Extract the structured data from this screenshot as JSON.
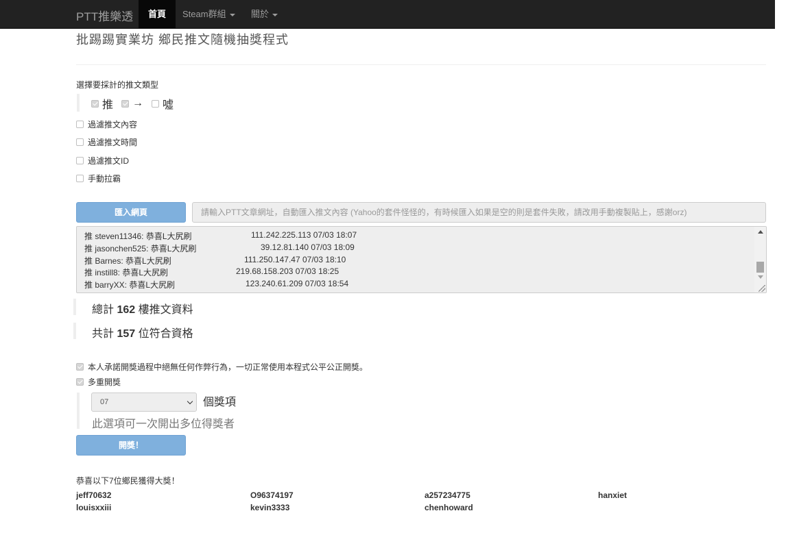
{
  "nav": {
    "brand": "PTT推樂透",
    "items": [
      {
        "label": "首頁"
      },
      {
        "label": "Steam群組"
      },
      {
        "label": "關於"
      }
    ]
  },
  "page": {
    "title": "批踢踢實業坊 鄉民推文隨機抽獎程式",
    "section_label": "選擇要採計的推文類型"
  },
  "push_types": [
    {
      "label": "推",
      "checked": true
    },
    {
      "label": "→",
      "checked": true
    },
    {
      "label": "噓",
      "checked": false
    }
  ],
  "filters": [
    {
      "label": "過濾推文內容",
      "checked": false
    },
    {
      "label": "過濾推文時間",
      "checked": false
    },
    {
      "label": "過濾推文ID",
      "checked": false
    },
    {
      "label": "手動拉霸",
      "checked": false
    }
  ],
  "import": {
    "button_label": "匯入網頁",
    "placeholder": "請輸入PTT文章網址，自動匯入推文內容 (Yahoo的套件怪怪的，有時候匯入如果是空的則是套件失敗，請改用手動複製貼上，感謝orz)"
  },
  "push_lines": [
    {
      "text": "推 steven11346: 恭喜L大尻刷",
      "meta": "111.242.225.113 07/03 18:07"
    },
    {
      "text": "推 jasonchen525: 恭喜L大尻刷",
      "meta": "39.12.81.140 07/03 18:09"
    },
    {
      "text": "推 Barnes: 恭喜L大尻刷",
      "meta": "111.250.147.47 07/03 18:10"
    },
    {
      "text": "推 instill8: 恭喜L大尻刷",
      "meta": "219.68.158.203 07/03 18:25"
    },
    {
      "text": "推 barryXX: 恭喜L大尻刷",
      "meta": "123.240.61.209 07/03 18:54"
    }
  ],
  "stats": {
    "total_prefix": "總計",
    "total_count": "162",
    "total_suffix": "樓推文資料",
    "eligible_prefix": "共計",
    "eligible_count": "157",
    "eligible_suffix": "位符合資格"
  },
  "options": {
    "promise_label": "本人承諾開獎過程中絕無任何作弊行為，一切正常使用本程式公平公正開獎。",
    "promise_checked": true,
    "multi_label": "多重開獎",
    "multi_checked": true,
    "prize_count": "07",
    "prize_suffix": "個獎項",
    "help": "此選項可一次開出多位得獎者"
  },
  "draw_button": "開獎！",
  "winners": {
    "title": "恭喜以下7位鄉民獲得大獎！",
    "names": [
      "jeff70632",
      "O96374197",
      "a257234775",
      "hanxiet",
      "louisxxiii",
      "kevin3333",
      "chenhoward"
    ]
  }
}
